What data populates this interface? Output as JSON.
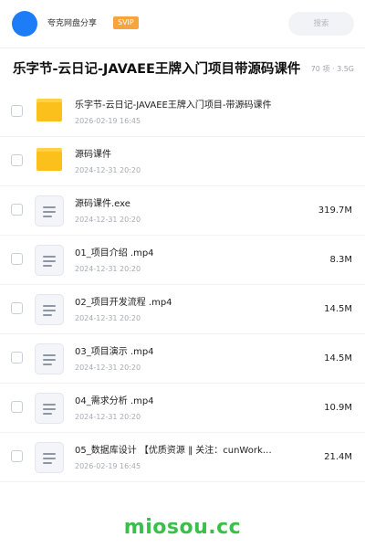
{
  "header": {
    "user_name": "夸克网盘分享",
    "badge": "SVIP",
    "search_placeholder": "搜索"
  },
  "title": {
    "text": "乐字节-云日记-JAVAEE王牌入门项目带源码课件",
    "meta": "70 项 · 3.5G"
  },
  "files": [
    {
      "type": "folder",
      "name": "乐字节-云日记-JAVAEE王牌入门项目-带源码课件",
      "date": "2026-02-19 16:45",
      "size": ""
    },
    {
      "type": "folder",
      "name": "源码课件",
      "date": "2024-12-31 20:20",
      "size": ""
    },
    {
      "type": "file",
      "name": "源码课件.exe",
      "date": "2024-12-31 20:20",
      "size": "319.7M"
    },
    {
      "type": "file",
      "name": "01_项目介绍 .mp4",
      "date": "2024-12-31 20:20",
      "size": "8.3M"
    },
    {
      "type": "file",
      "name": "02_项目开发流程 .mp4",
      "date": "2024-12-31 20:20",
      "size": "14.5M"
    },
    {
      "type": "file",
      "name": "03_项目演示 .mp4",
      "date": "2024-12-31 20:20",
      "size": "14.5M"
    },
    {
      "type": "file",
      "name": "04_需求分析 .mp4",
      "date": "2024-12-31 20:20",
      "size": "10.9M"
    },
    {
      "type": "file",
      "name": "05_数据库设计 【优质资源 ‖ 关注：cunWork…",
      "date": "2026-02-19 16:45",
      "size": "21.4M"
    }
  ],
  "footer": {
    "watermark": "miosou.cc"
  },
  "colors": {
    "avatar": "#1e7cf6",
    "badge": "#f7a43c",
    "folder": "#fcc01d",
    "watermark": "#3bbf4a"
  }
}
